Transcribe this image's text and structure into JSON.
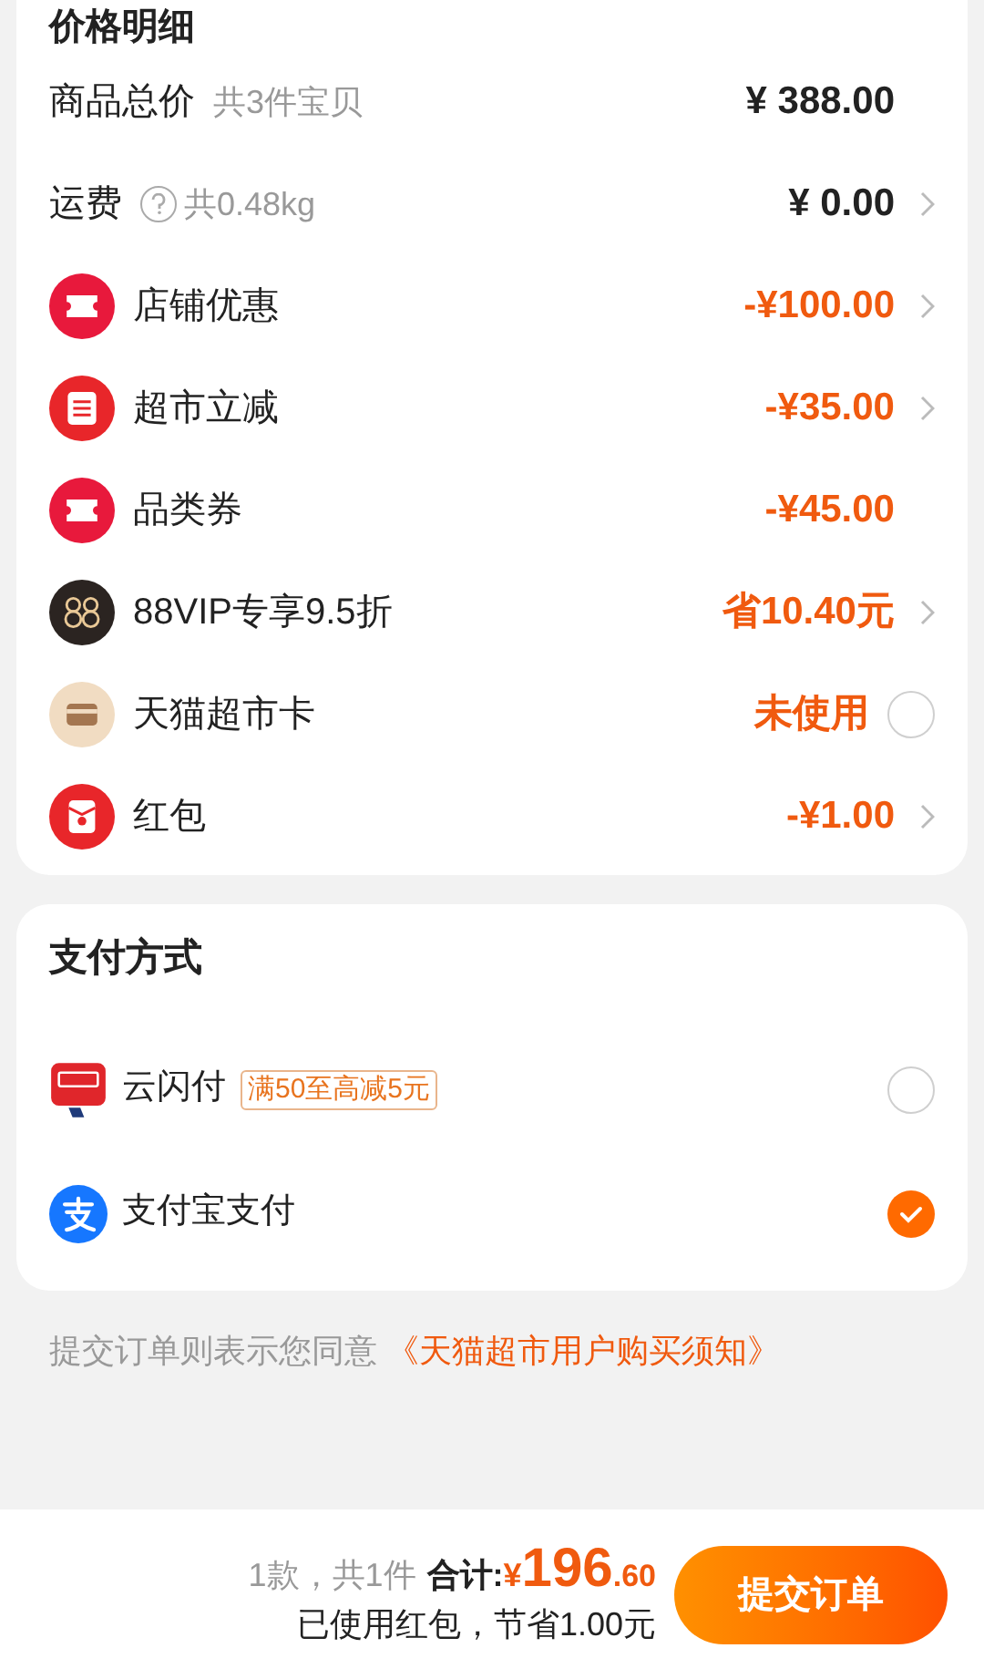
{
  "price_section": {
    "title": "价格明细",
    "rows": [
      {
        "kind": "plain",
        "label": "商品总价",
        "note": "共3件宝贝",
        "amount": "¥ 388.00",
        "chevron": false
      },
      {
        "kind": "plain",
        "label": "运费",
        "help": true,
        "note": "共0.48kg",
        "amount": "¥ 0.00",
        "chevron": true
      },
      {
        "kind": "ticket",
        "label": "店铺优惠",
        "amount": "-¥100.00",
        "chevron": true
      },
      {
        "kind": "cut",
        "label": "超市立减",
        "amount": "-¥35.00",
        "chevron": true
      },
      {
        "kind": "ticket",
        "label": "品类券",
        "amount": "-¥45.00",
        "chevron": false
      },
      {
        "kind": "vip",
        "label": "88VIP专享9.5折",
        "amount": "省10.40元",
        "chevron": true
      },
      {
        "kind": "card",
        "label": "天猫超市卡",
        "amount": "未使用",
        "chevron": false,
        "radio": {
          "checked": false
        }
      },
      {
        "kind": "redpacket",
        "label": "红包",
        "amount": "-¥1.00",
        "chevron": true
      }
    ]
  },
  "payment_section": {
    "title": "支付方式",
    "methods": [
      {
        "kind": "unionpay",
        "name": "云闪付",
        "badge": "满50至高减5元",
        "selected": false
      },
      {
        "kind": "alipay",
        "name": "支付宝支付",
        "selected": true
      }
    ]
  },
  "agreement": {
    "text": "提交订单则表示您同意",
    "link": "《天猫超市用户购买须知》"
  },
  "footer": {
    "count": "1款，共1件",
    "total_label": "合计:",
    "currency": "¥",
    "total_integer": "196",
    "total_decimal": ".60",
    "savings": "已使用红包，节省1.00元",
    "submit": "提交订单"
  }
}
